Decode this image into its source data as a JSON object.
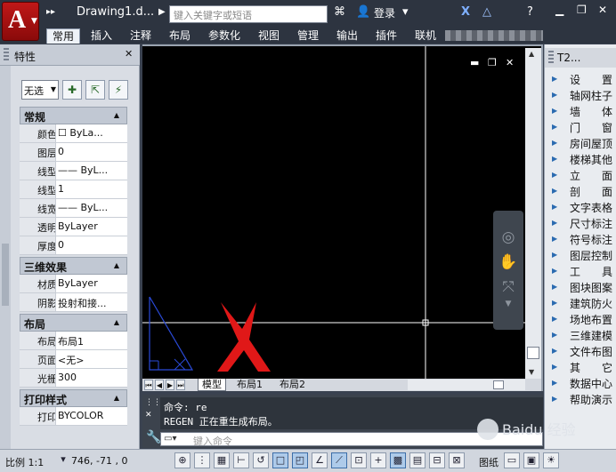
{
  "titlebar": {
    "app_logo": "A",
    "doc_title": "Drawing1.d...",
    "search_placeholder": "键入关键字或短语",
    "login_label": "登录",
    "icons": [
      "binoculars-icon",
      "user-icon",
      "x-exchange-icon",
      "triangle-icon",
      "help-icon",
      "minimize-icon",
      "restore-icon",
      "close-icon"
    ]
  },
  "ribbon": {
    "tabs": [
      "常用",
      "插入",
      "注释",
      "布局",
      "参数化",
      "视图",
      "管理",
      "输出",
      "插件",
      "联机"
    ],
    "active_tab": "常用"
  },
  "properties": {
    "title": "特性",
    "selection": "无选",
    "sections": [
      {
        "name": "常规",
        "rows": [
          {
            "key": "颜色",
            "value": "ByLa..."
          },
          {
            "key": "图层",
            "value": "0"
          },
          {
            "key": "线型",
            "value": "—— ByL..."
          },
          {
            "key": "线型...",
            "value": "1"
          },
          {
            "key": "线宽",
            "value": "—— ByL..."
          },
          {
            "key": "透明度",
            "value": "ByLayer"
          },
          {
            "key": "厚度",
            "value": "0"
          }
        ]
      },
      {
        "name": "三维效果",
        "rows": [
          {
            "key": "材质",
            "value": "ByLayer"
          },
          {
            "key": "阴影...",
            "value": "投射和接..."
          }
        ]
      },
      {
        "name": "布局",
        "rows": [
          {
            "key": "布局...",
            "value": "布局1"
          },
          {
            "key": "页面...",
            "value": "<无>"
          },
          {
            "key": "光栅...",
            "value": "300"
          }
        ]
      },
      {
        "name": "打印样式",
        "rows": [
          {
            "key": "打印...",
            "value": "BYCOLOR"
          }
        ]
      }
    ]
  },
  "layout_tabs": [
    "模型",
    "布局1",
    "布局2"
  ],
  "command": {
    "history": [
      "命令: re",
      "REGEN 正在重生成布局。"
    ],
    "input_placeholder": "键入命令"
  },
  "tool_panel": {
    "title": "T2...",
    "items": [
      "设　　置",
      "轴网柱子",
      "墙　　体",
      "门　　窗",
      "房间屋顶",
      "楼梯其他",
      "立　　面",
      "剖　　面",
      "文字表格",
      "尺寸标注",
      "符号标注",
      "图层控制",
      "工　　具",
      "图块图案",
      "建筑防火",
      "场地布置",
      "三维建模",
      "文件布图",
      "其　　它",
      "数据中心",
      "帮助演示"
    ]
  },
  "status": {
    "scale": "比例 1:1",
    "coords": "746, -71 , 0",
    "drawing_label": "图纸"
  },
  "watermark": "Baidu 经验",
  "colors": {
    "canvas": "#000000",
    "crosshair": "#ffffff",
    "annotation": "#e01818",
    "triangle": "#2a4ad8"
  }
}
